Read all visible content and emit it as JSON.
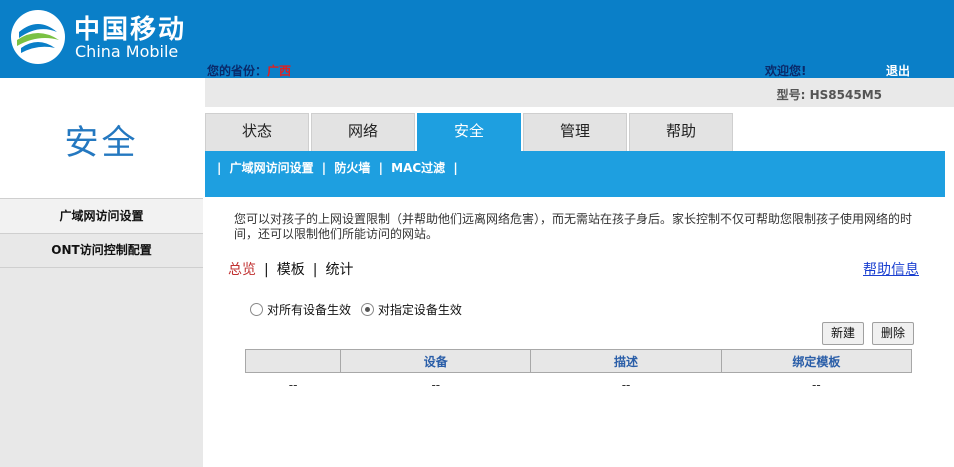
{
  "header": {
    "brand_cn": "中国移动",
    "brand_en": "China Mobile",
    "province_label": "您的省份：",
    "province_value": "广西",
    "welcome": "欢迎您!",
    "logout": "退出",
    "model": "型号: HS8545M5"
  },
  "colors": {
    "header_bg": "#0a7fc8",
    "tab_active": "#1e9fe0",
    "subnav_bg": "#1e9fe0"
  },
  "tabs": [
    {
      "label": "状态"
    },
    {
      "label": "网络"
    },
    {
      "label": "安全",
      "active": true
    },
    {
      "label": "管理"
    },
    {
      "label": "帮助"
    }
  ],
  "subnav": {
    "sep": "|",
    "items": [
      "广域网访问设置",
      "防火墙",
      "MAC过滤"
    ]
  },
  "left": {
    "title": "安全",
    "items": [
      "广域网访问设置",
      "ONT访问控制配置"
    ]
  },
  "main": {
    "description": "您可以对孩子的上网设置限制（并帮助他们远离网络危害），而无需站在孩子身后。家长控制不仅可帮助您限制孩子使用网络的时间，还可以限制他们所能访问的网站。",
    "links": {
      "overview": "总览",
      "template": "模板",
      "stats": "统计",
      "sep": "|"
    },
    "help": "帮助信息",
    "radio_all": "对所有设备生效",
    "radio_specific": "对指定设备生效",
    "btn_new": "新建",
    "btn_delete": "删除",
    "table": {
      "headers": [
        "",
        "设备",
        "描述",
        "绑定模板"
      ],
      "rows": [
        [
          "--",
          "--",
          "--",
          "--"
        ]
      ]
    }
  }
}
